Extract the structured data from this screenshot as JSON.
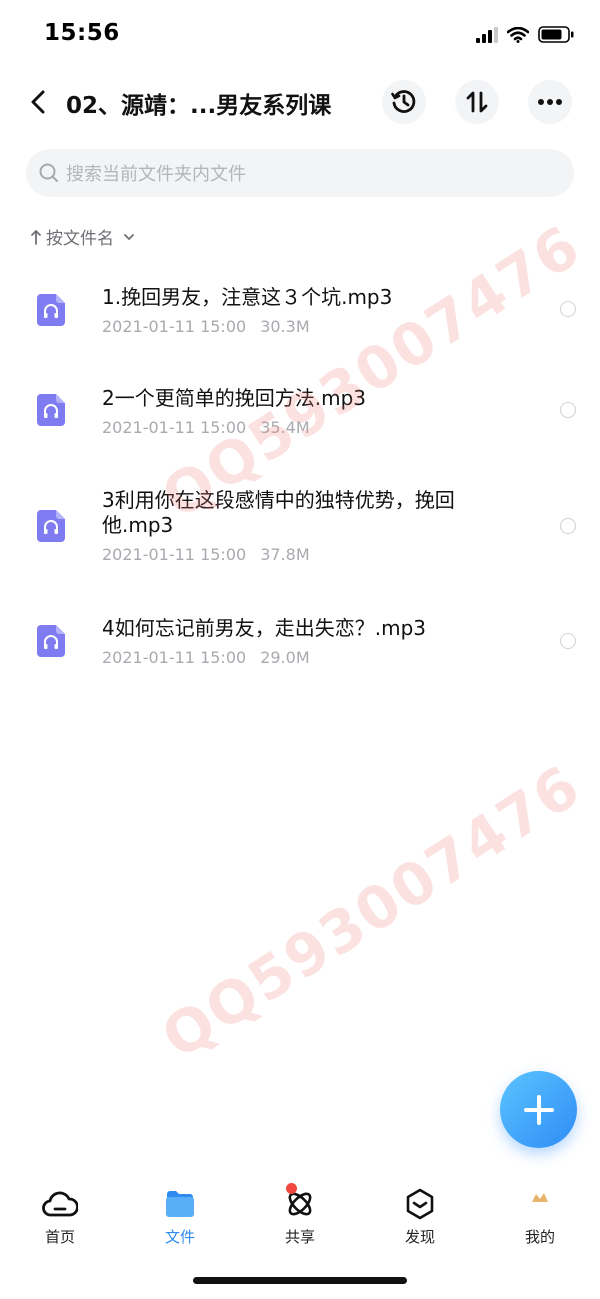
{
  "status_bar": {
    "time": "15:56"
  },
  "header": {
    "title": "02、源靖：...男友系列课",
    "buttons": [
      "history-icon",
      "sort-arrows-icon",
      "more-icon"
    ]
  },
  "search": {
    "placeholder": "搜索当前文件夹内文件"
  },
  "sort": {
    "label": "按文件名"
  },
  "files": [
    {
      "name": "1.挽回男友，注意这３个坑.mp3",
      "date": "2021-01-11 15:00",
      "size": "30.3M"
    },
    {
      "name": "2一个更简单的挽回方法.mp3",
      "date": "2021-01-11 15:00",
      "size": "35.4M"
    },
    {
      "name": "3利用你在这段感情中的独特优势，挽回他.mp3",
      "date": "2021-01-11 15:00",
      "size": "37.8M"
    },
    {
      "name": "4如何忘记前男友，走出失恋？.mp3",
      "date": "2021-01-11 15:00",
      "size": "29.0M"
    }
  ],
  "watermark": "QQ593007476",
  "tabs": [
    {
      "label": "首页",
      "icon": "cloud-icon"
    },
    {
      "label": "文件",
      "icon": "folder-icon",
      "active": true
    },
    {
      "label": "共享",
      "icon": "atom-icon",
      "badge": true
    },
    {
      "label": "发现",
      "icon": "box-icon"
    },
    {
      "label": "我的",
      "icon": "avatar-icon"
    }
  ],
  "colors": {
    "accent": "#2f8bf0",
    "file_icon": "#7e7cf0",
    "badge": "#f0473f",
    "watermark": "#f07878"
  }
}
